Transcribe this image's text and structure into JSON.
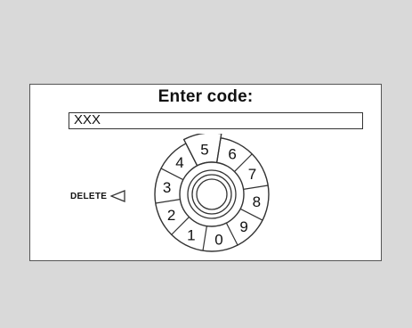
{
  "dialog": {
    "title": "Enter code:",
    "code_value": "XXX"
  },
  "dial": {
    "selected_digit": "5",
    "digits": [
      "5",
      "6",
      "7",
      "8",
      "9",
      "0",
      "1",
      "2",
      "3",
      "4"
    ],
    "delete_label": "DELETE",
    "delete_icon": "triangle-left-icon",
    "center_icon": "concentric-knob-icon"
  },
  "colors": {
    "background": "#d9d9d9",
    "panel": "#ffffff",
    "stroke": "#333333"
  }
}
